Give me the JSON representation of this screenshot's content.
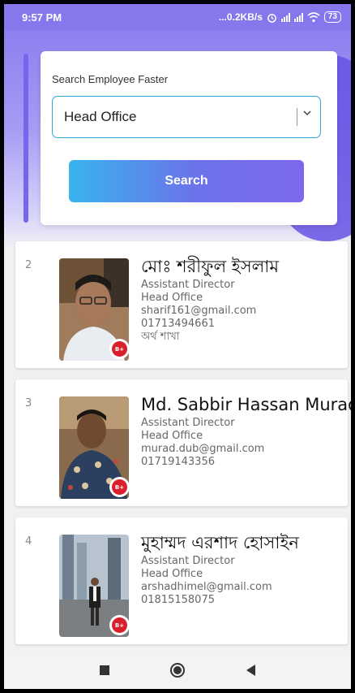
{
  "status_bar": {
    "time": "9:57 PM",
    "network_speed": "...0.2KB/s",
    "battery": "73"
  },
  "search": {
    "label": "Search Employee Faster",
    "selected_office": "Head Office",
    "button_label": "Search"
  },
  "employees": [
    {
      "index": "2",
      "name": "মোঃ শরীফুল ইসলাম",
      "designation": "Assistant Director",
      "office": "Head Office",
      "email": "sharif161@gmail.com",
      "phone": "01713494661",
      "branch": "অর্থ শাখা",
      "blood_group": "B+"
    },
    {
      "index": "3",
      "name": "Md. Sabbir Hassan Murad",
      "designation": "Assistant Director",
      "office": "Head Office",
      "email": "murad.dub@gmail.com",
      "phone": "01719143356",
      "blood_group": "B+"
    },
    {
      "index": "4",
      "name": "মুহাম্মদ এরশাদ হোসাইন",
      "designation": "Assistant Director",
      "office": "Head Office",
      "email": "arshadhimel@gmail.com",
      "phone": "01815158075",
      "blood_group": "B+"
    }
  ],
  "colors": {
    "accent": "#7566ec",
    "blood_badge": "#d81f2b"
  }
}
